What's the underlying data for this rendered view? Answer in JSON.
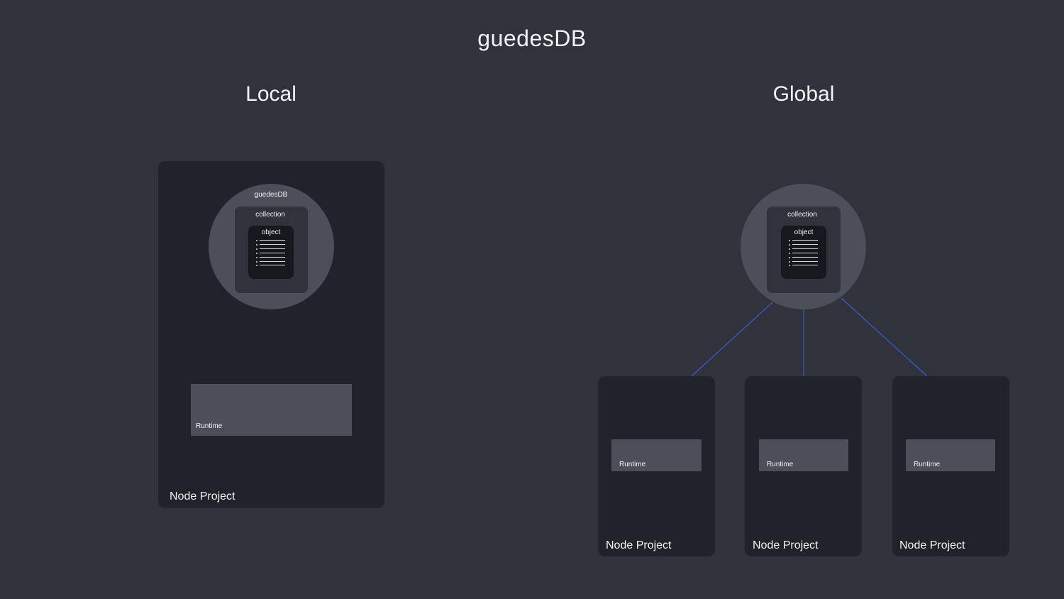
{
  "title": "guedesDB",
  "local": {
    "heading": "Local",
    "db_label": "guedesDB",
    "collection_label": "collection",
    "object_label": "object",
    "runtime_label": "Runtime",
    "project_label": "Node Project"
  },
  "global": {
    "heading": "Global",
    "collection_label": "collection",
    "object_label": "object",
    "projects": [
      {
        "runtime_label": "Runtime",
        "project_label": "Node Project"
      },
      {
        "runtime_label": "Runtime",
        "project_label": "Node Project"
      },
      {
        "runtime_label": "Runtime",
        "project_label": "Node Project"
      }
    ]
  },
  "colors": {
    "background": "#30333c",
    "panel": "#21232a",
    "node": "#4b4f5a",
    "connector": "#3a5bd0"
  }
}
